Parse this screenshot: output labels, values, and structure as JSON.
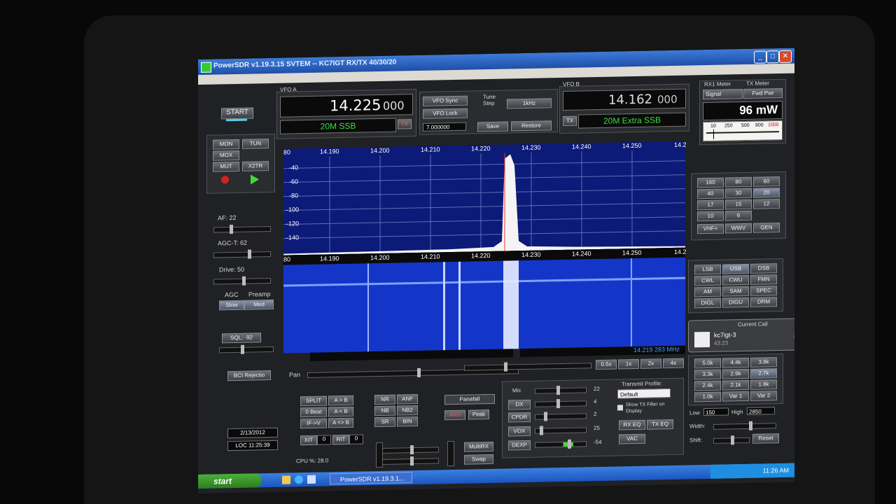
{
  "window": {
    "title": "PowerSDR  v1.19.3.15  SVTEM  --  KC7IGT RX/TX 40/30/20"
  },
  "power": {
    "start_label": "START"
  },
  "left_buttons": [
    "MON",
    "TUN",
    "MOX",
    "",
    "MUT",
    "X2TR"
  ],
  "controls": {
    "af": "AF: 22",
    "agc_t": "AGC-T: 62",
    "drive": "Drive: 50",
    "agc_label": "AGC",
    "preamp_label": "Preamp",
    "agc_value": "Slow",
    "preamp_value": "Med",
    "sql": "SQL: -92",
    "bci": "BCI Rejectio",
    "date": "2/13/2012",
    "time": "LOC 11:25:39",
    "cpu": "CPU %: 28.0"
  },
  "vfo_a": {
    "label": "VFO A",
    "freq_main": "14.225",
    "freq_sub": "000",
    "band": "20M SSB",
    "tx_badge": "TX"
  },
  "vfo_mid": {
    "sync": "VFO Sync",
    "lock": "VFO Lock",
    "tune_step_label": "Tune Step",
    "tune_step": "1kHz",
    "mem_freq": "7.000000",
    "save": "Save",
    "restore": "Restore"
  },
  "vfo_b": {
    "label": "VFO B",
    "freq_main": "14.162",
    "freq_sub": "000",
    "band": "20M Extra SSB",
    "tx_badge": "TX"
  },
  "meter": {
    "rx_label": "RX1 Meter",
    "tx_label": "TX Meter",
    "rx_sel": "Signal",
    "tx_sel": "Fwd Pwr",
    "reading": "96 mW",
    "scale": [
      "10",
      "250",
      "500",
      "800",
      "1000"
    ]
  },
  "bands": [
    [
      "160",
      "80",
      "60"
    ],
    [
      "40",
      "30",
      "20"
    ],
    [
      "17",
      "15",
      "12"
    ],
    [
      "10",
      "6",
      ""
    ],
    [
      "VHF+",
      "WWV",
      "GEN"
    ]
  ],
  "modes": [
    [
      "LSB",
      "USB",
      "DSB"
    ],
    [
      "CWL",
      "CWU",
      "FMN"
    ],
    [
      "AM",
      "SAM",
      "SPEC"
    ],
    [
      "DIGL",
      "DIGU",
      "DRM"
    ]
  ],
  "current_call": {
    "title": "Current Call",
    "name": "kc7igt-3",
    "duration": "43:23"
  },
  "filters": [
    [
      "5.0k",
      "4.4k",
      "3.8k"
    ],
    [
      "3.3k",
      "2.9k",
      "2.7k"
    ],
    [
      "2.4k",
      "2.1k",
      "1.8k"
    ],
    [
      "1.0k",
      "Var 1",
      "Var 2"
    ]
  ],
  "filter_ctrl": {
    "low_label": "Low",
    "low": "150",
    "high_label": "High",
    "high": "2850",
    "width": "Width:",
    "shift": "Shift:",
    "reset": "Reset"
  },
  "panadapter": {
    "freq_ticks": [
      "80",
      "14.190",
      "14.200",
      "14.210",
      "14.220",
      "14.230",
      "14.240",
      "14.250",
      "14.2"
    ],
    "db_ticks": [
      "-40",
      "-60",
      "-80",
      "-100",
      "-120",
      "-140"
    ],
    "cursor_readout": "14.219 283 MHz",
    "pan_label": "Pan",
    "zoom": [
      "0.5x",
      "1x",
      "2x",
      "4x"
    ]
  },
  "dsp": {
    "split": "SPLIT",
    "ab1": "A > B",
    "zero": "0 Beat",
    "ab2": "A < B",
    "ifv": "IF->V",
    "swap": "A <> B",
    "xit": "XIT",
    "xit_val": "0",
    "rit": "RIT",
    "rit_val": "0",
    "nr": "NR",
    "anf": "ANF",
    "nb": "NB",
    "nb2": "NB2",
    "sr": "SR",
    "bin": "BIN",
    "display_mode": "Panafall",
    "avg": "AVG",
    "peak": "Peak",
    "multirx": "MultiRX",
    "swap2": "Swap"
  },
  "tx": {
    "mic": "Mic",
    "mic_val": "22",
    "dx": "DX",
    "dx_val": "4",
    "cpdr": "CPDR",
    "cpdr_val": "2",
    "vox": "VOX",
    "vox_val": "25",
    "dexp": "DEXP",
    "dexp_val": "-54",
    "profile_label": "Transmit Profile:",
    "profile": "Default",
    "show_filter": "Show TX Filter on Display",
    "rx_eq": "RX EQ",
    "tx_eq": "TX EQ",
    "vac": "VAC"
  },
  "taskbar": {
    "start": "start",
    "item": "PowerSDR  v1.19.3.1...",
    "clock": "11:26 AM"
  },
  "colors": {
    "spectrum_bg": "#0c1a78",
    "waterfall_bg": "#1436c8",
    "accent_green": "#3ddc3d",
    "title_blue": "#2a64c8"
  }
}
